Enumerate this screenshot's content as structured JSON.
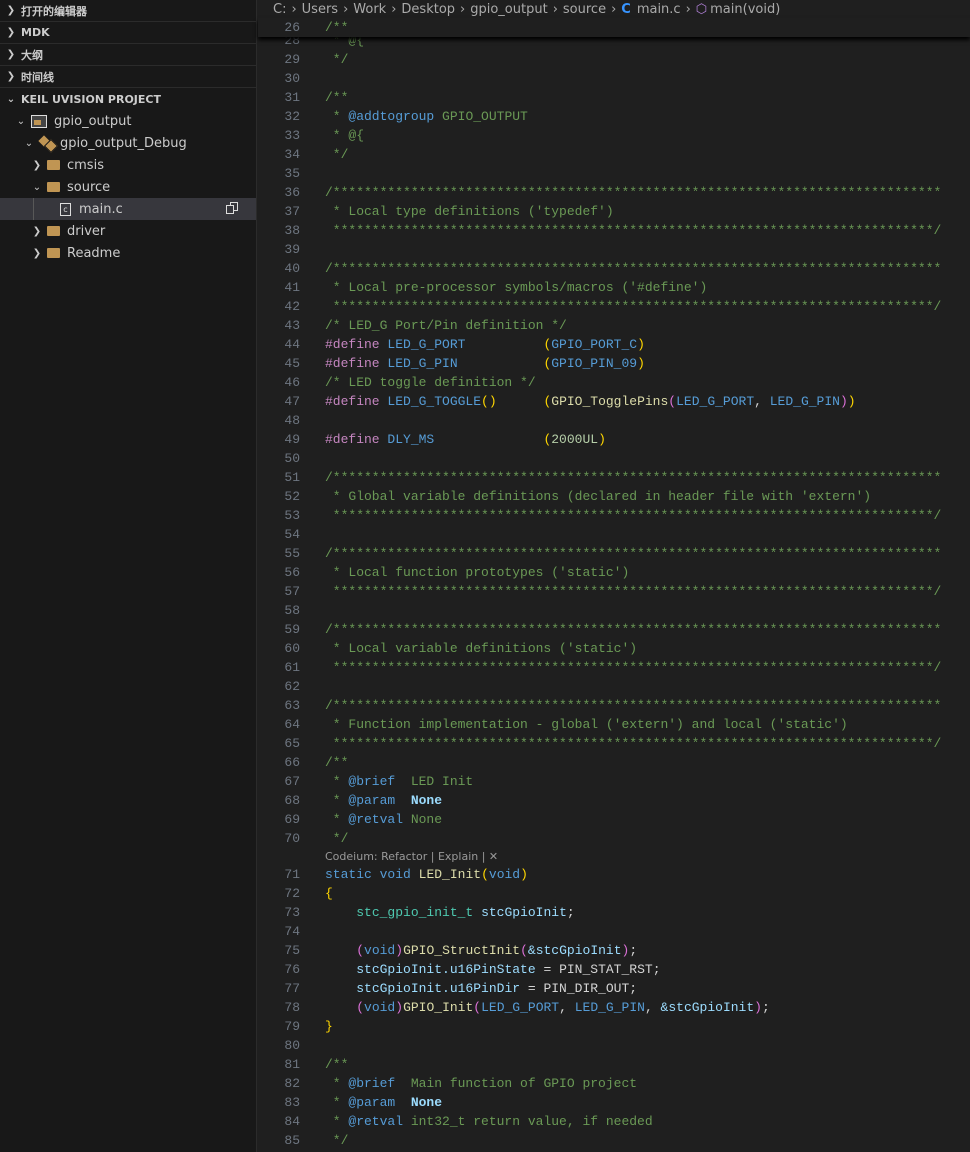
{
  "sidebar": {
    "sections": [
      "打开的编辑器",
      "MDK",
      "大纲",
      "时间线"
    ],
    "project_header": "KEIL UVISION PROJECT",
    "tree": {
      "project": "gpio_output",
      "target": "gpio_output_Debug",
      "cmsis": "cmsis",
      "source": "source",
      "file": "main.c",
      "driver": "driver",
      "readme": "Readme",
      "file_glyph": "c"
    }
  },
  "breadcrumb": {
    "items": [
      "C:",
      "Users",
      "Work",
      "Desktop",
      "gpio_output",
      "source"
    ],
    "file": "main.c",
    "file_icon": "C",
    "symbol": "main(void)"
  },
  "lens": {
    "text": "Codeium: Refactor | Explain | ✕"
  },
  "sticky": {
    "n": 26,
    "t": [
      [
        "/**",
        "c"
      ]
    ]
  },
  "code": {
    "before_lens": [
      {
        "n": 28,
        "t": [
          [
            " * @{",
            "c"
          ]
        ]
      },
      {
        "n": 29,
        "t": [
          [
            " */",
            "c"
          ]
        ]
      },
      {
        "n": 30,
        "t": []
      },
      {
        "n": 31,
        "t": [
          [
            "/**",
            "c"
          ]
        ]
      },
      {
        "n": 32,
        "t": [
          [
            " * ",
            "c"
          ],
          [
            "@addtogroup",
            "tag"
          ],
          [
            " GPIO_OUTPUT",
            "c"
          ]
        ]
      },
      {
        "n": 33,
        "t": [
          [
            " * @{",
            "c"
          ]
        ]
      },
      {
        "n": 34,
        "t": [
          [
            " */",
            "c"
          ]
        ]
      },
      {
        "n": 35,
        "t": []
      },
      {
        "n": 36,
        "t": [
          [
            "/******************************************************************************",
            "c"
          ]
        ]
      },
      {
        "n": 37,
        "t": [
          [
            " * Local type definitions ('typedef')",
            "c"
          ]
        ]
      },
      {
        "n": 38,
        "t": [
          [
            " *****************************************************************************/",
            "c"
          ]
        ]
      },
      {
        "n": 39,
        "t": []
      },
      {
        "n": 40,
        "t": [
          [
            "/******************************************************************************",
            "c"
          ]
        ]
      },
      {
        "n": 41,
        "t": [
          [
            " * Local pre-processor symbols/macros ('#define')",
            "c"
          ]
        ]
      },
      {
        "n": 42,
        "t": [
          [
            " *****************************************************************************/",
            "c"
          ]
        ]
      },
      {
        "n": 43,
        "t": [
          [
            "/* LED_G Port/Pin definition */",
            "c"
          ]
        ]
      },
      {
        "n": 44,
        "t": [
          [
            "#define",
            "p"
          ],
          [
            " LED_G_PORT          ",
            "m"
          ],
          [
            "(",
            "b1"
          ],
          [
            "GPIO_PORT_C",
            "m"
          ],
          [
            ")",
            "b1"
          ]
        ]
      },
      {
        "n": 45,
        "t": [
          [
            "#define",
            "p"
          ],
          [
            " LED_G_PIN           ",
            "m"
          ],
          [
            "(",
            "b1"
          ],
          [
            "GPIO_PIN_09",
            "m"
          ],
          [
            ")",
            "b1"
          ]
        ]
      },
      {
        "n": 46,
        "t": [
          [
            "/* LED toggle definition */",
            "c"
          ]
        ]
      },
      {
        "n": 47,
        "t": [
          [
            "#define",
            "p"
          ],
          [
            " LED_G_TOGGLE",
            "m"
          ],
          [
            "()",
            "b1"
          ],
          [
            "      ",
            "w"
          ],
          [
            "(",
            "b1"
          ],
          [
            "GPIO_TogglePins",
            "f"
          ],
          [
            "(",
            "b2"
          ],
          [
            "LED_G_PORT",
            "m"
          ],
          [
            ", ",
            "w"
          ],
          [
            "LED_G_PIN",
            "m"
          ],
          [
            ")",
            "b2"
          ],
          [
            ")",
            "b1"
          ]
        ]
      },
      {
        "n": 48,
        "t": []
      },
      {
        "n": 49,
        "t": [
          [
            "#define",
            "p"
          ],
          [
            " DLY_MS              ",
            "m"
          ],
          [
            "(",
            "b1"
          ],
          [
            "2000UL",
            "n"
          ],
          [
            ")",
            "b1"
          ]
        ]
      },
      {
        "n": 50,
        "t": []
      },
      {
        "n": 51,
        "t": [
          [
            "/******************************************************************************",
            "c"
          ]
        ]
      },
      {
        "n": 52,
        "t": [
          [
            " * Global variable definitions (declared in header file with 'extern')",
            "c"
          ]
        ]
      },
      {
        "n": 53,
        "t": [
          [
            " *****************************************************************************/",
            "c"
          ]
        ]
      },
      {
        "n": 54,
        "t": []
      },
      {
        "n": 55,
        "t": [
          [
            "/******************************************************************************",
            "c"
          ]
        ]
      },
      {
        "n": 56,
        "t": [
          [
            " * Local function prototypes ('static')",
            "c"
          ]
        ]
      },
      {
        "n": 57,
        "t": [
          [
            " *****************************************************************************/",
            "c"
          ]
        ]
      },
      {
        "n": 58,
        "t": []
      },
      {
        "n": 59,
        "t": [
          [
            "/******************************************************************************",
            "c"
          ]
        ]
      },
      {
        "n": 60,
        "t": [
          [
            " * Local variable definitions ('static')",
            "c"
          ]
        ]
      },
      {
        "n": 61,
        "t": [
          [
            " *****************************************************************************/",
            "c"
          ]
        ]
      },
      {
        "n": 62,
        "t": []
      },
      {
        "n": 63,
        "t": [
          [
            "/******************************************************************************",
            "c"
          ]
        ]
      },
      {
        "n": 64,
        "t": [
          [
            " * Function implementation - global ('extern') and local ('static')",
            "c"
          ]
        ]
      },
      {
        "n": 65,
        "t": [
          [
            " *****************************************************************************/",
            "c"
          ]
        ]
      },
      {
        "n": 66,
        "t": [
          [
            "/**",
            "c"
          ]
        ]
      },
      {
        "n": 67,
        "t": [
          [
            " * ",
            "c"
          ],
          [
            "@brief",
            "tag"
          ],
          [
            "  LED Init",
            "c"
          ]
        ]
      },
      {
        "n": 68,
        "t": [
          [
            " * ",
            "c"
          ],
          [
            "@param",
            "tag"
          ],
          [
            "  ",
            "c"
          ],
          [
            "None",
            "nb"
          ]
        ]
      },
      {
        "n": 69,
        "t": [
          [
            " * ",
            "c"
          ],
          [
            "@retval",
            "tag"
          ],
          [
            " None",
            "c"
          ]
        ]
      },
      {
        "n": 70,
        "t": [
          [
            " */",
            "c"
          ]
        ]
      }
    ],
    "after_lens": [
      {
        "n": 71,
        "t": [
          [
            "static",
            "k"
          ],
          [
            " ",
            "w"
          ],
          [
            "void",
            "k"
          ],
          [
            " ",
            "w"
          ],
          [
            "LED_Init",
            "f"
          ],
          [
            "(",
            "b1"
          ],
          [
            "void",
            "k"
          ],
          [
            ")",
            "b1"
          ]
        ]
      },
      {
        "n": 72,
        "t": [
          [
            "{",
            "b1"
          ]
        ]
      },
      {
        "n": 73,
        "t": [
          [
            "    ",
            "w"
          ],
          [
            "stc_gpio_init_t",
            "t"
          ],
          [
            " ",
            "w"
          ],
          [
            "stcGpioInit",
            "v"
          ],
          [
            ";",
            "w"
          ]
        ]
      },
      {
        "n": 74,
        "t": []
      },
      {
        "n": 75,
        "t": [
          [
            "    ",
            "w"
          ],
          [
            "(",
            "b2"
          ],
          [
            "void",
            "k"
          ],
          [
            ")",
            "b2"
          ],
          [
            "GPIO_StructInit",
            "f"
          ],
          [
            "(",
            "b2"
          ],
          [
            "&stcGpioInit",
            "v"
          ],
          [
            ")",
            "b2"
          ],
          [
            ";",
            "w"
          ]
        ]
      },
      {
        "n": 76,
        "t": [
          [
            "    ",
            "w"
          ],
          [
            "stcGpioInit.u16PinState",
            "v"
          ],
          [
            " = ",
            "w"
          ],
          [
            "PIN_STAT_RST",
            "w"
          ],
          [
            ";",
            "w"
          ]
        ]
      },
      {
        "n": 77,
        "t": [
          [
            "    ",
            "w"
          ],
          [
            "stcGpioInit.u16PinDir",
            "v"
          ],
          [
            " = ",
            "w"
          ],
          [
            "PIN_DIR_OUT",
            "w"
          ],
          [
            ";",
            "w"
          ]
        ]
      },
      {
        "n": 78,
        "t": [
          [
            "    ",
            "w"
          ],
          [
            "(",
            "b2"
          ],
          [
            "void",
            "k"
          ],
          [
            ")",
            "b2"
          ],
          [
            "GPIO_Init",
            "f"
          ],
          [
            "(",
            "b2"
          ],
          [
            "LED_G_PORT",
            "m"
          ],
          [
            ", ",
            "w"
          ],
          [
            "LED_G_PIN",
            "m"
          ],
          [
            ", ",
            "w"
          ],
          [
            "&stcGpioInit",
            "v"
          ],
          [
            ")",
            "b2"
          ],
          [
            ";",
            "w"
          ]
        ]
      },
      {
        "n": 79,
        "t": [
          [
            "}",
            "b1"
          ]
        ]
      },
      {
        "n": 80,
        "t": []
      },
      {
        "n": 81,
        "t": [
          [
            "/**",
            "c"
          ]
        ]
      },
      {
        "n": 82,
        "t": [
          [
            " * ",
            "c"
          ],
          [
            "@brief",
            "tag"
          ],
          [
            "  Main function of GPIO project",
            "c"
          ]
        ]
      },
      {
        "n": 83,
        "t": [
          [
            " * ",
            "c"
          ],
          [
            "@param",
            "tag"
          ],
          [
            "  ",
            "c"
          ],
          [
            "None",
            "nb"
          ]
        ]
      },
      {
        "n": 84,
        "t": [
          [
            " * ",
            "c"
          ],
          [
            "@retval",
            "tag"
          ],
          [
            " int32_t return value, if needed",
            "c"
          ]
        ]
      },
      {
        "n": 85,
        "t": [
          [
            " */",
            "c"
          ]
        ]
      }
    ]
  }
}
